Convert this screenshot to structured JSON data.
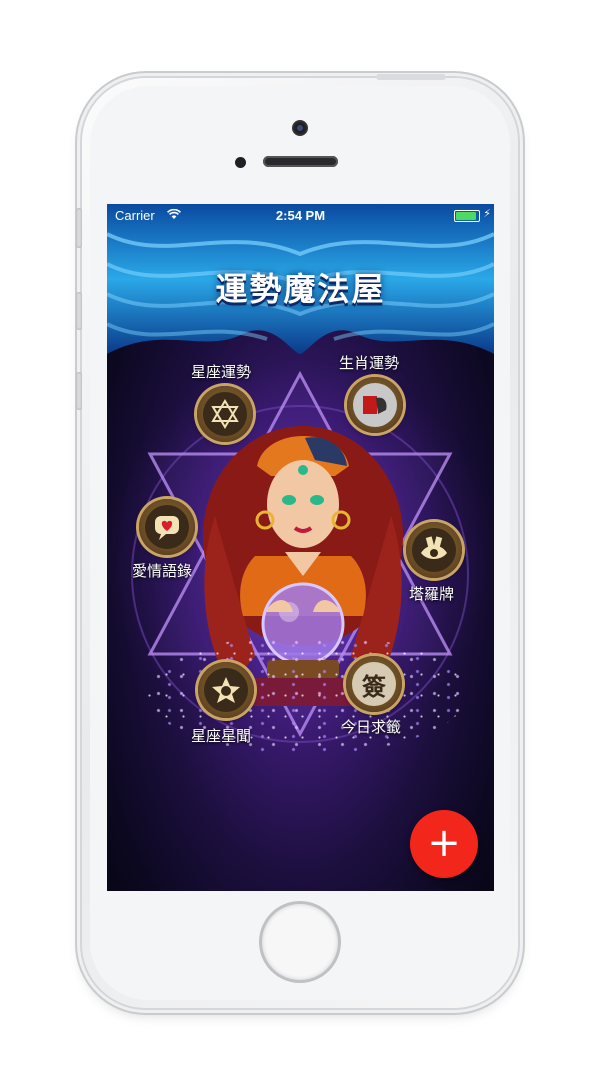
{
  "status_bar": {
    "carrier": "Carrier",
    "time": "2:54 PM",
    "battery_level": 1.0,
    "battery_color": "#4cd964"
  },
  "app": {
    "title": "運勢魔法屋"
  },
  "menu": {
    "horoscope": {
      "label": "星座運勢",
      "icon": "hexagram-icon"
    },
    "zodiac": {
      "label": "生肖運勢",
      "icon": "zodiac-icon"
    },
    "love_quotes": {
      "label": "愛情語錄",
      "icon": "heart-chat-icon"
    },
    "tarot": {
      "label": "塔羅牌",
      "icon": "tarot-eye-icon"
    },
    "astro_news": {
      "label": "星座星聞",
      "icon": "star-globe-icon"
    },
    "daily_lot": {
      "label": "今日求籤",
      "icon": "lot-icon",
      "icon_text": "簽"
    }
  },
  "fab": {
    "label": "+",
    "color": "#f2261a"
  }
}
